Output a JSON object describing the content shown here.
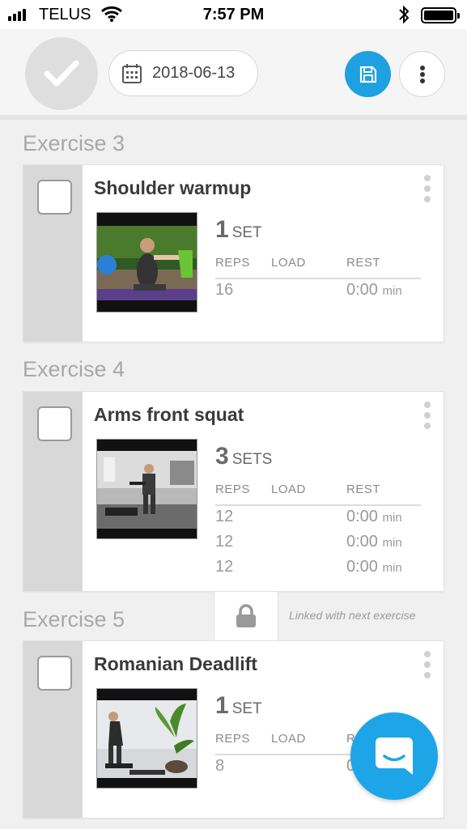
{
  "status_bar": {
    "carrier": "TELUS",
    "time": "7:57 PM"
  },
  "toolbar": {
    "date": "2018-06-13",
    "accent_color": "#1fa0e0"
  },
  "exercises": [
    {
      "title": "Exercise 3",
      "name": "Shoulder warmup",
      "sets_count": "1",
      "sets_label": "SET",
      "headers": {
        "reps": "REPS",
        "load": "LOAD",
        "rest": "REST"
      },
      "rows": [
        {
          "reps": "16",
          "rest": "0:00",
          "unit": "min"
        }
      ]
    },
    {
      "title": "Exercise 4",
      "name": "Arms front squat",
      "sets_count": "3",
      "sets_label": "SETS",
      "headers": {
        "reps": "REPS",
        "load": "LOAD",
        "rest": "REST"
      },
      "rows": [
        {
          "reps": "12",
          "rest": "0:00",
          "unit": "min"
        },
        {
          "reps": "12",
          "rest": "0:00",
          "unit": "min"
        },
        {
          "reps": "12",
          "rest": "0:00",
          "unit": "min"
        }
      ]
    },
    {
      "title": "Exercise 5",
      "name": "Romanian Deadlift",
      "sets_count": "1",
      "sets_label": "SET",
      "headers": {
        "reps": "REPS",
        "load": "LOAD",
        "rest": "R"
      },
      "rows": [
        {
          "reps": "8",
          "rest": "0"
        }
      ]
    }
  ],
  "link": {
    "text": "Linked with next exercise"
  },
  "icons": {
    "complete": "checkmark-icon",
    "calendar": "calendar-icon",
    "save": "save-icon",
    "more": "more-vertical-icon",
    "lock": "lock-icon",
    "chat": "chat-icon"
  }
}
